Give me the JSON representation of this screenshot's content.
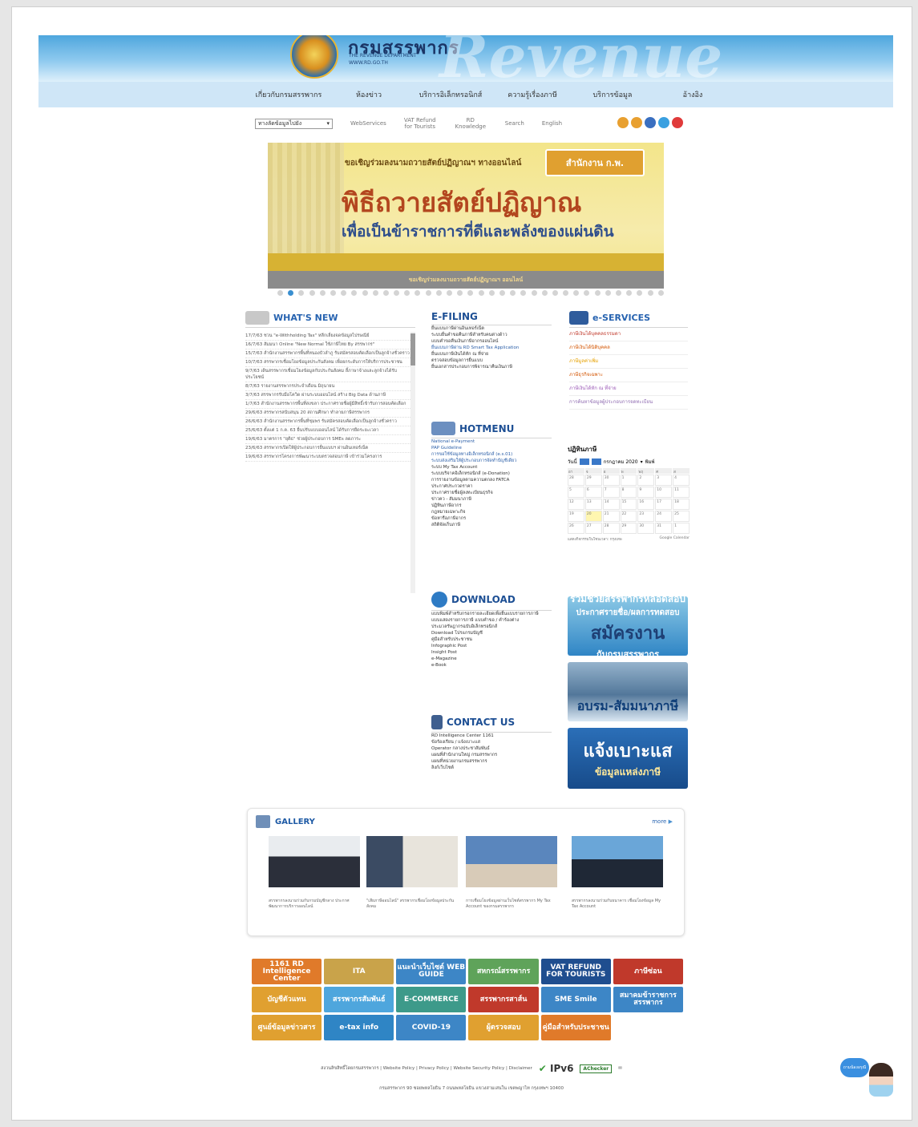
{
  "header": {
    "brand": "กรมสรรพากร",
    "sub1": "THE REVENUE DEPARTMENT",
    "sub2": "WWW.RD.GO.TH",
    "watermark": "Revenue"
  },
  "main_nav": [
    "เกี่ยวกับกรมสรรพากร",
    "ห้องข่าว",
    "บริการอิเล็กทรอนิกส์",
    "ความรู้เรื่องภาษี",
    "บริการข้อมูล",
    "อ้างอิง"
  ],
  "toolbar": {
    "select_value": "ทางลัดข้อมูลไปยัง",
    "links": [
      "WebServices",
      "VAT Refund for Tourists",
      "RD Knowledge",
      "Search",
      "English"
    ],
    "social_colors": [
      "#e8a030",
      "#e8a030",
      "#3a6fc0",
      "#3aa0e0",
      "#e03a3a"
    ]
  },
  "banner": {
    "lead": "ขอเชิญร่วมลงนามถวายสัตย์ปฏิญาณฯ ทางออนไลน์",
    "logo": "สำนักงาน ก.พ.",
    "title": "พิธีถวายสัตย์ปฏิญาณ",
    "subtitle": "เพื่อเป็นข้าราชการที่ดีและพลังของแผ่นดิน",
    "caption": "ขอเชิญร่วมลงนามถวายสัตย์ปฏิญาณฯ ออนไลน์"
  },
  "whats_new": {
    "title": "WHAT'S NEW",
    "items": [
      "17/7/63 ชวน \"e-Withholding Tax\" หลีกเลี่ยงจดข้อมูลไปรษณีย์",
      "16/7/63 สัมมนา Online \"New Normal ใช้ภาษีไทย By สรรพากร\"",
      "15/7/63 สำนักงานสรรพากรพื้นที่หนองบัวลำภู รับสมัครสอบคัดเลือกเป็นลูกจ้างชั่วคราว",
      "10/7/63 สรรพากรเชื่อมโยงข้อมูลประกันสังคม เพื่อยกระดับการให้บริการประชาชน",
      "9/7/63 เดินสรรพากรเชื่อมโยงข้อมูลกับประกันสังคม ลี้ภาษาจ้างและลูกจ้างได้รับประโยชน์",
      "8/7/63 รายงานสรรพากรประจำเดือน มิถุนายน",
      "3/7/63 สรรพากรรับมือโควิด ผ่านระบบออนไลน์ สร้าง Big Data ด้านภาษี",
      "1/7/63 สำนักงานสรรพากรพื้นที่สงขลา ประกาศรายชื่อผู้มีสิทธิ์เข้ารับการสอบคัดเลือก",
      "29/6/63 สรรพากรสนับสนุน 20 สถานศึกษา ทำลายภาษีสรรพากร",
      "26/6/63 สำนักงานสรรพากรพื้นที่ชุมพร รับสมัครสอบคัดเลือกเป็นลูกจ้างชั่วคราว",
      "25/6/63 ตั้งแต่ 1 ก.ค. 63 ยื่นปรับแบบออนไลน์ ได้รับการยืดระยะเวลา",
      "19/6/63 มาตรการ \"ยุติธ\" ช่วยผู้ประกอบการ SMEs ลดภาระ",
      "23/6/63 สรรพากรเปิดให้ผู้ประกอบการยื่นแบบฯ ผ่านอินเทอร์เน็ต",
      "19/6/63 สรรพากรโครงการพัฒนาระบบตรวจสอบภาษี เข้าร่วมโครงการ"
    ]
  },
  "efiling": {
    "title": "E-FILING",
    "items": [
      "ยื่นแบบภาษีผ่านอินเทอร์เน็ต",
      "ระบบยื่นคำขอคืนภาษีสำหรับคนต่างด้าว",
      "แบบคำขอคืนเงินภาษีอากรออนไลน์",
      "ยื่นแบบภาษีผ่าน RD Smart Tax Application",
      "ยื่นแบบภาษีเงินได้หัก ณ ที่จ่าย",
      "ตรวจสอบข้อมูลการยื่นแบบ",
      "ยื่นเอกสารประกอบการพิจารณาคืนเงินภาษี"
    ]
  },
  "hotmenu": {
    "title": "HOTMENU",
    "items": [
      "National e-Payment",
      "PAP Guideline",
      "การขอใช้ข้อมูลทางอิเล็กทรอนิกส์ (e.s.01)",
      "ระบบส่งเสริมให้ผู้ประกอบการจัดทำบัญชีเดียว",
      "ระบบ My Tax Account",
      "ระบบบริจาคอิเล็กทรอนิกส์ (e-Donation)",
      "การรายงานข้อมูลตามความตกลง FATCA",
      "ประกาศประกวดราคา",
      "ประกาศรายชื่อผู้ลงทะเบียนธุรกิจ",
      "ข่าวคว - สัมมนาภาษี",
      "ปฏิทินภาษีอากร",
      "กฎหมายเฉพาะกิจ",
      "ข้อหารือภาษีอากร",
      "สถิติจัดเก็บภาษี"
    ]
  },
  "download": {
    "title": "DOWNLOAD",
    "items": [
      "แบบพิมพ์สำหรับกรอกรายละเอียดเพื่อยื่นแบบรายการภาษี",
      "แบบแสดงรายการภาษี แบบคำขอ / คำร้องต่าง",
      "ประมวลรัษฎากรฉบับอิเล็กทรอนิกส์",
      "Download โปรแกรมบัญชี",
      "คู่มือสำหรับประชาชน",
      "Infographic Post",
      "Insight Post",
      "e-Magazine",
      "e-Book"
    ]
  },
  "contact": {
    "title": "CONTACT US",
    "items": [
      "RD Intelligence Center 1161",
      "ข้อร้องเรียน / แจ้งเบาะแส",
      "Operator กลางประชาสัมพันธ์",
      "แผนที่สำนักงานใหญ่ กรมสรรพากร",
      "แผนที่หน่วยงานกรมสรรพากร",
      "ลิงก์เว็บไซต์"
    ]
  },
  "eservices": {
    "title": "e-SERVICES",
    "items": [
      {
        "label": "ภาษีเงินได้บุคคลธรรมดา",
        "color": "#c0392b"
      },
      {
        "label": "ภาษีเงินได้นิติบุคคล",
        "color": "#d35400"
      },
      {
        "label": "ภาษีมูลค่าเพิ่ม",
        "color": "#e6a100"
      },
      {
        "label": "ภาษีธุรกิจเฉพาะ",
        "color": "#d35400"
      },
      {
        "label": "ภาษีเงินได้หัก ณ ที่จ่าย",
        "color": "#9b59b6"
      },
      {
        "label": "การค้นหาข้อมูลผู้ประกอบการจดทะเบียน",
        "color": "#8e6ab0"
      }
    ]
  },
  "calendar": {
    "title": "ปฏิทินภาษี",
    "today": "วันนี้",
    "month": "กรกฎาคม 2020",
    "print": "พิมพ์",
    "weekdays": [
      "อา",
      "จ",
      "อ",
      "พ",
      "พฤ",
      "ศ",
      "ส"
    ],
    "days": [
      "28",
      "29",
      "30",
      "1",
      "2",
      "3",
      "4",
      "5",
      "6",
      "7",
      "8",
      "9",
      "10",
      "11",
      "12",
      "13",
      "14",
      "15",
      "16",
      "17",
      "18",
      "19",
      "20",
      "21",
      "22",
      "23",
      "24",
      "25",
      "26",
      "27",
      "28",
      "29",
      "30",
      "31",
      "1"
    ],
    "highlight_index": 22,
    "foot_left": "แสดงกิจกรรมในโซนเวลา: กรุงเทพ",
    "foot_right": "Google Calendar"
  },
  "side_banners": {
    "b1": {
      "line1": "ร่วมช่วยสรรพากรหลอดสอบ",
      "line2": "ประกาศรายชื่อ/ผลการทดสอบ",
      "line3": "สมัครงาน",
      "line4": "กับกรมสรรพากร"
    },
    "b2": {
      "line1": "อบรม-สัมมนาภาษี"
    },
    "b3": {
      "line1": "แจ้งเบาะแส",
      "line2": "ข้อมูลแหล่งภาษี"
    }
  },
  "gallery": {
    "title": "GALLERY",
    "more": "more",
    "captions": [
      "สรรพากรลงนามร่วมกับกรมบัญชีกลาง ประกาศพัฒนาการบริการออนไลน์",
      "\"เสียภาษีออนไลน์\" สรรพากรเชื่อมโยงข้อมูลประกันสังคม",
      "การเชื่อมโยงข้อมูลผ่านเว็บไซต์สรรพากร My Tax Account ของกรมสรรพากร",
      "สรรพากรลงนามร่วมกับธนาคาร เชื่อมโยงข้อมูล My Tax Account"
    ]
  },
  "quick_links": [
    {
      "label": "1161 RD Intelligence Center",
      "bg": "#e07a2a"
    },
    {
      "label": "ITA",
      "bg": "#c9a34a"
    },
    {
      "label": "แนะนำเว็บไซต์ WEB GUIDE",
      "bg": "#3d86c6"
    },
    {
      "label": "สหกรณ์สรรพากร",
      "bg": "#5fa35a"
    },
    {
      "label": "VAT REFUND FOR TOURISTS",
      "bg": "#1f4e8f"
    },
    {
      "label": "ภาษีซ่อน",
      "bg": "#c0392b"
    },
    {
      "label": "บัญชีตัวแทน",
      "bg": "#e0a030"
    },
    {
      "label": "สรรพากรสัมพันธ์",
      "bg": "#4ea6dd"
    },
    {
      "label": "E-COMMERCE",
      "bg": "#3d9a8a"
    },
    {
      "label": "สรรพากรสาส์น",
      "bg": "#c0392b"
    },
    {
      "label": "SME Smile",
      "bg": "#3d86c6"
    },
    {
      "label": "สมาคมข้าราชการสรรพากร",
      "bg": "#3d86c6"
    },
    {
      "label": "ศูนย์ข้อมูลข่าวสาร",
      "bg": "#e0a030"
    },
    {
      "label": "e-tax info",
      "bg": "#2f85c5"
    },
    {
      "label": "COVID-19",
      "bg": "#3d86c6"
    },
    {
      "label": "ผู้ตรวจสอบ",
      "bg": "#e0a030"
    },
    {
      "label": "คู่มือสำหรับประชาชน",
      "bg": "#e07a2a"
    }
  ],
  "footer": {
    "line1": "สงวนลิขสิทธิ์โดยกรมสรรพากร | Website Policy | Privacy Policy | Website Security Policy | Disclaimer",
    "ipv6": "IPv6",
    "achecker": "AChecker",
    "line2": "กรมสรรพากร 90 ซอยพหลโยธิน 7 ถนนพหลโยธิน แขวงสามเสนใน เขตพญาไท กรุงเทพฯ 10400"
  },
  "assistant": {
    "bubble": "ถามน้องอรุณี"
  }
}
